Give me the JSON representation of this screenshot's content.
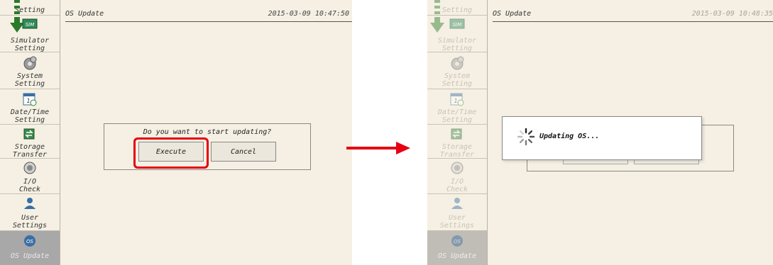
{
  "sidebar": {
    "items": [
      {
        "label": "Setting"
      },
      {
        "label": "Simulator\nSetting"
      },
      {
        "label": "System\nSetting"
      },
      {
        "label": "Date/Time\nSetting"
      },
      {
        "label": "Storage\nTransfer"
      },
      {
        "label": "I/O\nCheck"
      },
      {
        "label": "User\nSettings"
      },
      {
        "label": "OS Update"
      }
    ],
    "sim_badge": "SIM",
    "os_badge": "OS"
  },
  "left": {
    "title": "OS Update",
    "timestamp": "2015-03-09  10:47:50",
    "dialog": {
      "question": "Do you want to start updating?",
      "execute_label": "Execute",
      "cancel_label": "Cancel"
    }
  },
  "right": {
    "title": "OS Update",
    "timestamp": "2015-03-09  10:48:35",
    "popup": {
      "message": "Updating OS..."
    }
  },
  "colors": {
    "highlight": "#e60012",
    "arrow": "#e60012",
    "panel_bg": "#f5f0e3"
  }
}
